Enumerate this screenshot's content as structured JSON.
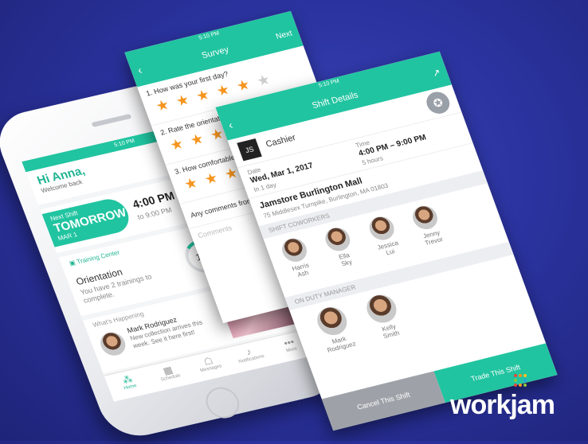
{
  "phone1": {
    "time": "5:10 PM",
    "greeting": "Hi Anna,",
    "welcome": "Welcome back",
    "next_shift_label": "Next Shift",
    "next_shift_day": "TOMORROW",
    "next_shift_date": "MAR 1",
    "next_shift_time": "4:00 PM",
    "next_shift_to": "to 9:00 PM",
    "training_center": "Training Center",
    "orientation": "Orientation",
    "orientation_text": "You have 2 trainings to complete.",
    "progress": "1/3",
    "whats_happening": "What's Happening",
    "post_author": "Mark Rodriguez",
    "post_text": "New collection arrives this week. See it here first!",
    "tabs": [
      {
        "label": "Home",
        "icon": "home-icon",
        "glyph": "⁂"
      },
      {
        "label": "Schedule",
        "icon": "calendar-icon",
        "glyph": "▦"
      },
      {
        "label": "Messages",
        "icon": "chat-icon",
        "glyph": "☖"
      },
      {
        "label": "Notifications",
        "icon": "bell-icon",
        "glyph": "♪"
      },
      {
        "label": "More",
        "icon": "more-icon",
        "glyph": "•••"
      }
    ]
  },
  "survey": {
    "time": "5:10 PM",
    "title": "Survey",
    "next": "Next",
    "q1": "1. How was your first day?",
    "q2": "2. Rate the orientation tra",
    "q3": "3. How comfortable are yo learned today?",
    "comments_q": "Any comments from this",
    "comments_placeholder": "Comments"
  },
  "shift": {
    "time": "5:10 PM",
    "title": "Shift Details",
    "role": "Cashier",
    "logo_initials": "JS",
    "date_label": "Date",
    "date": "Wed, Mar 1, 2017",
    "date_sub": "In 1 day",
    "time_label": "Time",
    "time_range": "4:00 PM – 9:00 PM",
    "time_sub": "5 hours",
    "store": "Jamstore Burlington Mall",
    "address": "75 Middlesex Turnpike, Burlington, MA 01803",
    "coworkers_label": "SHIFT COWORKERS",
    "coworkers": [
      {
        "first": "Harris",
        "last": "Ash"
      },
      {
        "first": "Ella",
        "last": "Sky"
      },
      {
        "first": "Jessica",
        "last": "Lui"
      },
      {
        "first": "Jenny",
        "last": "Trevor"
      }
    ],
    "managers_label": "ON DUTY MANAGER",
    "managers": [
      {
        "first": "Mark",
        "last": "Rodriguez"
      },
      {
        "first": "Kelly",
        "last": "Smith"
      }
    ],
    "cancel": "Cancel This Shift",
    "trade": "Trade This Shift"
  },
  "brand": {
    "name": "workjam",
    "accent": "#21c4a0",
    "dot_colors": [
      "#e8453c",
      "#f5951f",
      "#f8c12c",
      "#8cc63f",
      "#21c4a0",
      "#2fa0e0",
      "#e8453c",
      "#f5951f",
      "#8cc63f"
    ]
  }
}
